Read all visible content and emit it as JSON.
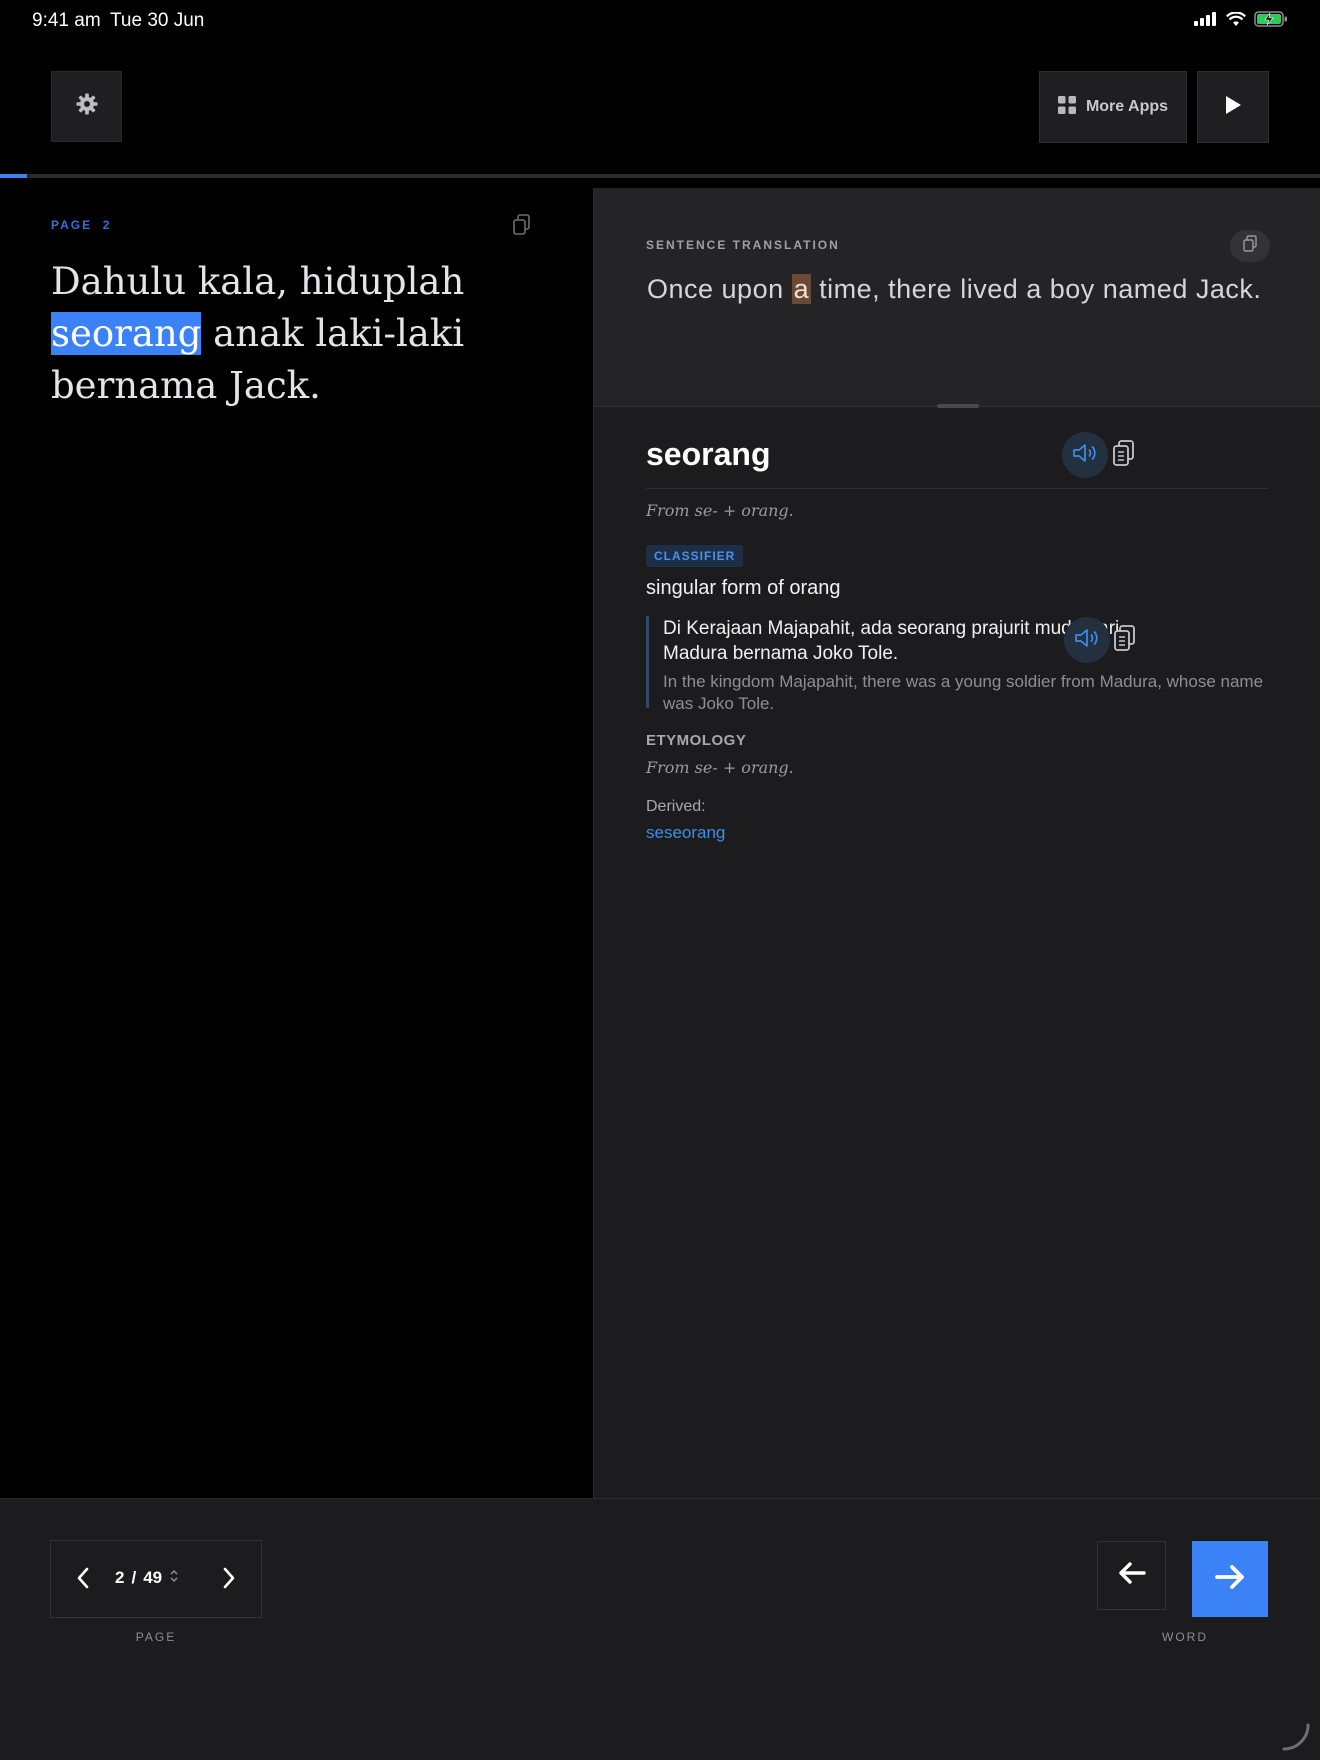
{
  "status_bar": {
    "time": "9:41 am",
    "date": "Tue 30 Jun"
  },
  "toolbar": {
    "more_apps_label": "More Apps"
  },
  "progress": {
    "fraction": 0.0204
  },
  "reader": {
    "page_label": "PAGE  2",
    "sentence": {
      "before": "Dahulu kala, hiduplah ",
      "highlight": "seorang",
      "after": " anak laki-laki bernama Jack."
    }
  },
  "translation": {
    "label": "SENTENCE TRANSLATION",
    "before": "Once upon ",
    "highlight": "a",
    "after": " time, there lived a boy named Jack."
  },
  "entry": {
    "word": "seorang",
    "origin": "From se- + orang.",
    "pos": "CLASSIFIER",
    "definition": "singular form of orang",
    "example_source": "Di Kerajaan Majapahit, ada seorang prajurit muda dari Madura bernama Joko Tole.",
    "example_translation": "In the kingdom Majapahit, there was a young soldier from Madura, whose name was Joko Tole.",
    "etymology_heading": "ETYMOLOGY",
    "etymology_text": "From se- + orang.",
    "derived_label": "Derived:",
    "derived_link": "seseorang"
  },
  "pager": {
    "current": "2",
    "separator": "/",
    "total": "49",
    "caption": "PAGE"
  },
  "word_nav": {
    "caption": "WORD"
  },
  "colors": {
    "accent": "#3b82f6",
    "highlight_translation": "#6a4a34",
    "background": "#000000",
    "panel": "#1c1c1e"
  }
}
